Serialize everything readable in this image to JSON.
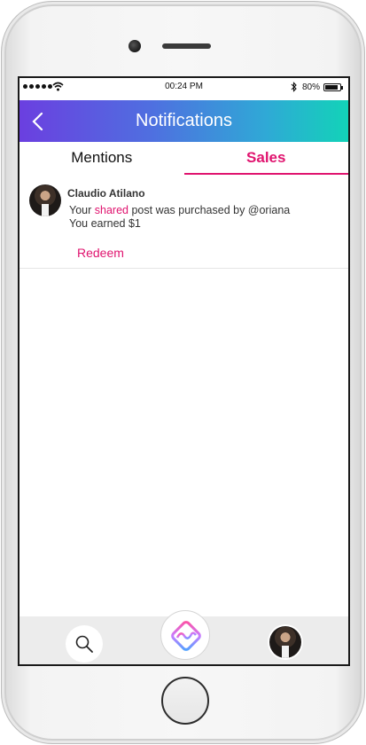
{
  "status_bar": {
    "time": "00:24 PM",
    "battery": "80%"
  },
  "header": {
    "title": "Notifications"
  },
  "tabs": [
    {
      "label": "Mentions",
      "active": false
    },
    {
      "label": "Sales",
      "active": true
    }
  ],
  "notifications": [
    {
      "user": "Claudio Atilano",
      "message_prefix": "Your",
      "highlight": "shared",
      "message_suffix": "post was purchased by @oriana",
      "earned": "You earned $1",
      "action": "Redeem"
    }
  ],
  "colors": {
    "accent": "#e0146f",
    "header_start": "#6b3fe0",
    "header_end": "#12d3b8"
  },
  "icons": {
    "back": "chevron-left-icon",
    "search": "search-icon",
    "logo": "app-logo-icon",
    "profile": "avatar"
  }
}
